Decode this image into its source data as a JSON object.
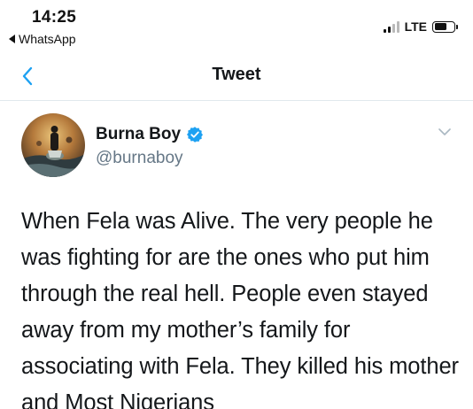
{
  "status_bar": {
    "time": "14:25",
    "back_app": "WhatsApp",
    "network": "LTE"
  },
  "nav": {
    "title": "Tweet",
    "back_icon": "chevron-left-icon",
    "accent_color": "#1da1f2"
  },
  "tweet": {
    "author_name": "Burna Boy",
    "handle": "@burnaboy",
    "verified": true,
    "verified_color": "#1da1f2",
    "text": "When Fela was Alive. The very people he was fighting for are the ones who put him through the real hell. People even stayed away from my mother’s family for associating with Fela. They killed his mother and Most Nigerians"
  }
}
